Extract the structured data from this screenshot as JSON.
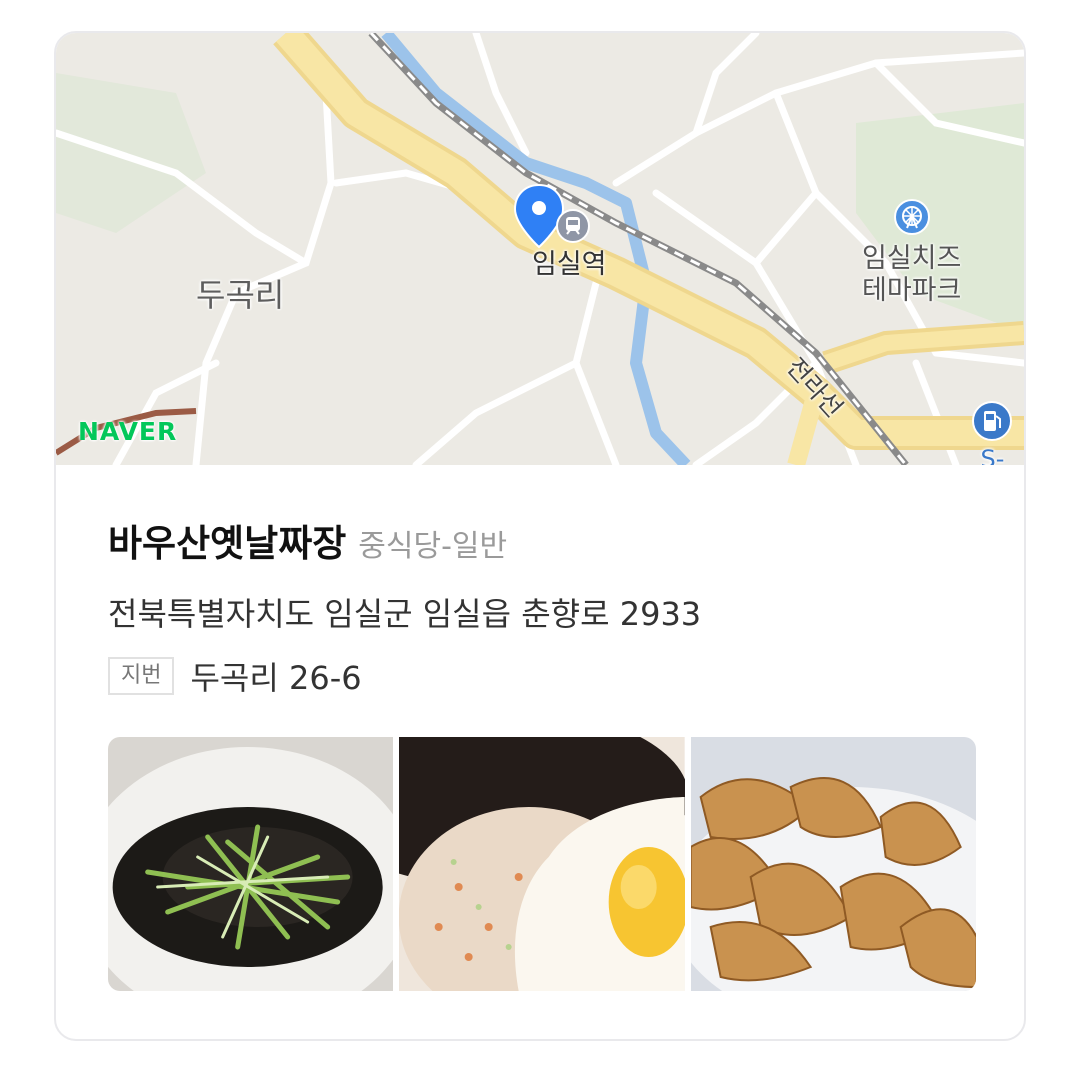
{
  "map": {
    "labels": {
      "station": "임실역",
      "area": "두곡리",
      "theme_park_line1": "임실치즈",
      "theme_park_line2": "테마파크",
      "rail_line": "전라선",
      "gas_station": "S-OIL",
      "naver_logo": "NAVER"
    },
    "icons": [
      "location-pin-icon",
      "train-station-icon",
      "ferris-wheel-icon",
      "gas-station-icon"
    ]
  },
  "place": {
    "name": "바우산옛날짜장",
    "category": "중식당-일반",
    "road_address": "전북특별자치도 임실군 임실읍 춘향로 2933",
    "jibun_label": "지번",
    "jibun_address": "두곡리 26-6"
  },
  "photos": [
    {
      "id": "jjajangmyeon-photo"
    },
    {
      "id": "fried-rice-photo"
    },
    {
      "id": "dumplings-photo"
    }
  ],
  "colors": {
    "naver_green": "#03c75a",
    "pin_blue": "#2f80f5",
    "road_yellow": "#f6df8f",
    "river_blue": "#9cc3ea"
  }
}
